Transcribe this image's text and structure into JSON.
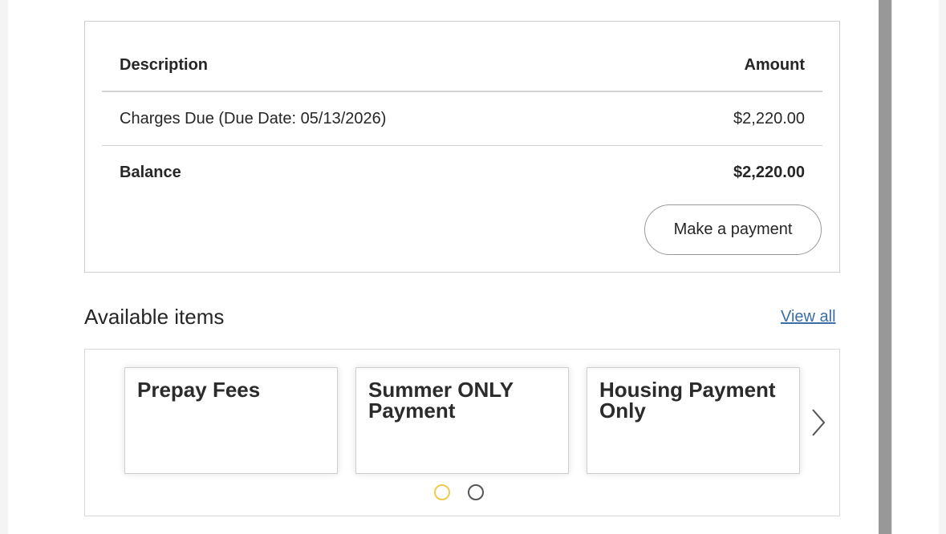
{
  "summary": {
    "headers": {
      "description": "Description",
      "amount": "Amount"
    },
    "rows": [
      {
        "description": "Charges Due (Due Date: 05/13/2026)",
        "amount": "$2,220.00"
      }
    ],
    "balance": {
      "label": "Balance",
      "amount": "$2,220.00"
    },
    "pay_button": "Make a payment"
  },
  "available": {
    "title": "Available items",
    "view_all": "View all",
    "items": [
      {
        "title": "Prepay Fees"
      },
      {
        "title": "Summer ONLY Payment"
      },
      {
        "title": "Housing Payment Only"
      }
    ],
    "pagination": {
      "pages": 2,
      "current": 1
    },
    "next_icon": "chevron-right-icon"
  },
  "colors": {
    "accent_link": "#3a6ea5",
    "active_dot": "#f2c94c",
    "scrollbar": "#989898"
  }
}
